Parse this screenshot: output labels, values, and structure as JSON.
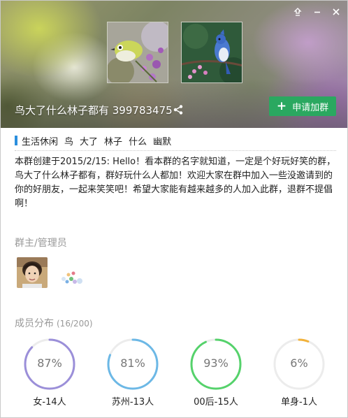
{
  "window": {
    "controls": {
      "pin_icon": "pin-icon",
      "minimize_icon": "minimize-icon",
      "close_icon": "close-icon"
    }
  },
  "header": {
    "group_name": "鸟大了什么林子都有 399783475",
    "share_icon": "share-icon",
    "join_button": {
      "icon": "plus-icon",
      "label": "申请加群",
      "color": "#2aa860"
    }
  },
  "tags": [
    "生活休闲",
    "鸟",
    "大了",
    "林子",
    "什么",
    "幽默"
  ],
  "description": "本群创建于2015/2/15:  Hello！看本群的名字就知道，一定是个好玩好笑的群，鸟大了什么林子都有，群好玩什么人都加！欢迎大家在群中加入一些没邀请到的你的好朋友，一起来笑笑吧！希望大家能有越来越多的人加入此群，退群不提倡啊！",
  "admins": {
    "title": "群主/管理员"
  },
  "members": {
    "title": "成员分布",
    "count": "(16/200)",
    "stats": [
      {
        "percent_text": "87%",
        "fraction": 0.87,
        "label": "女-14人",
        "color": "#9b8fd9"
      },
      {
        "percent_text": "81%",
        "fraction": 0.81,
        "label": "苏州-13人",
        "color": "#6cb8e6"
      },
      {
        "percent_text": "93%",
        "fraction": 0.93,
        "label": "00后-15人",
        "color": "#55d26b"
      },
      {
        "percent_text": "6%",
        "fraction": 0.06,
        "label": "单身-1人",
        "color": "#f2b23a"
      }
    ]
  }
}
